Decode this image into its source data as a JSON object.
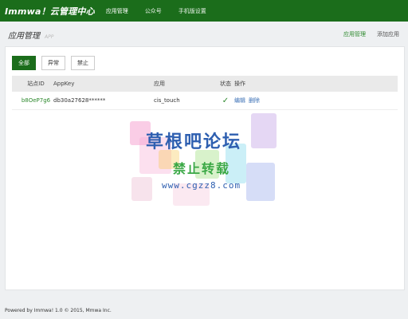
{
  "app": {
    "title": "Immwa！云管理中心"
  },
  "nav": {
    "items": [
      {
        "label": "应用管理",
        "active": true
      },
      {
        "label": "公众号",
        "active": false
      },
      {
        "label": "手机版设置",
        "active": false
      }
    ]
  },
  "page": {
    "title": "应用管理",
    "subtitle": "APP",
    "links": [
      {
        "label": "应用管理",
        "active": true
      },
      {
        "label": "添加应用",
        "active": false
      }
    ]
  },
  "filters": [
    {
      "label": "全部",
      "active": true
    },
    {
      "label": "异常",
      "active": false
    },
    {
      "label": "禁止",
      "active": false
    }
  ],
  "table": {
    "columns": [
      "站点ID",
      "AppKey",
      "应用",
      "状态",
      "操作"
    ],
    "rows": [
      {
        "site_id": "b8OeP7g6",
        "appkey": "db30a27628******",
        "app": "cis_touch",
        "status": "✓",
        "ops": [
          "编辑",
          "删除"
        ]
      }
    ]
  },
  "watermark": {
    "title": "草根吧论坛",
    "subtitle": "禁止转载",
    "url": "www.cgzz8.com"
  },
  "footer": {
    "text": "Powered by Immwa! 1.0 © 2015, Mmwa Inc."
  },
  "colors": {
    "brand": "#1b6d1b",
    "accent": "#2f8a2f",
    "link": "#3a6fb5"
  }
}
